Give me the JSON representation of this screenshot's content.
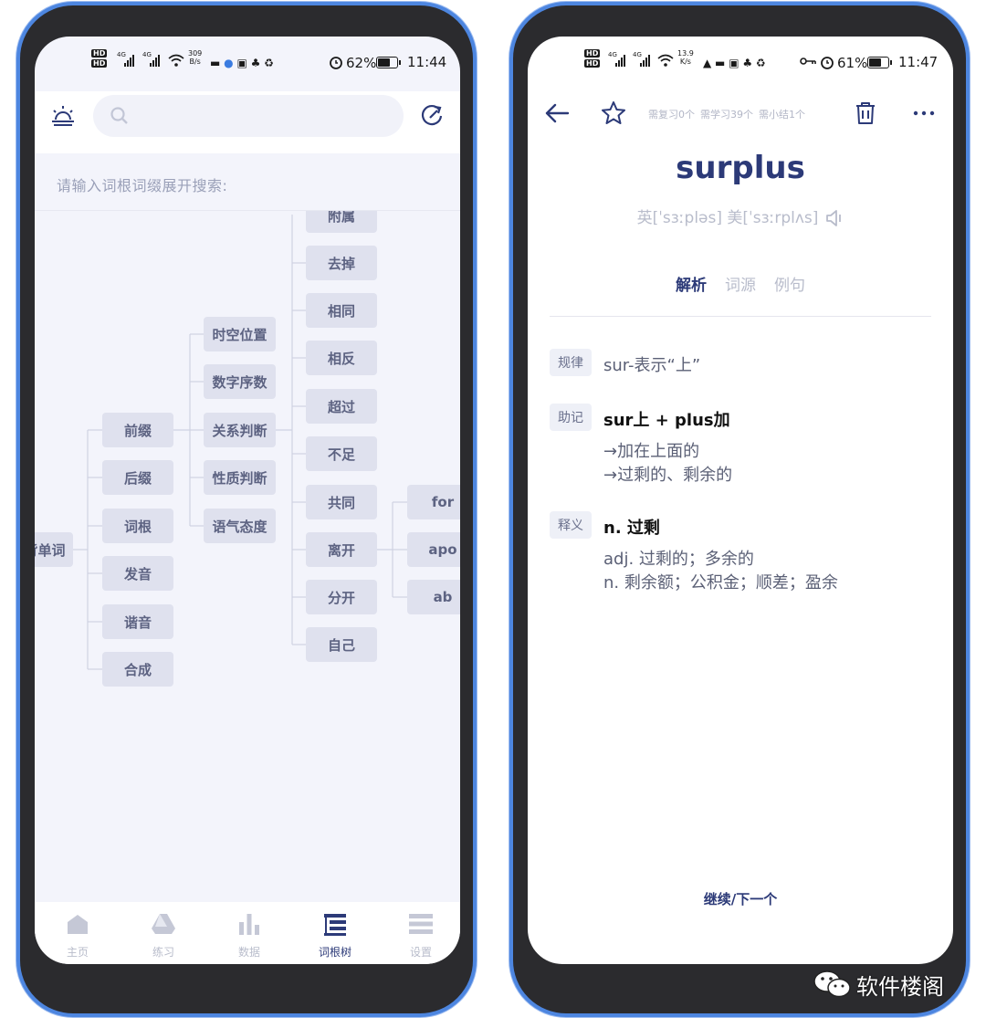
{
  "left": {
    "status": {
      "hd1": "HD",
      "hd2": "HD",
      "net1": "4G",
      "net2": "4G",
      "speed_value": "309",
      "speed_unit": "B/s",
      "battery": "62%",
      "time": "11:44"
    },
    "search": {
      "placeholder": ""
    },
    "hint": "请输入词根词缀展开搜索:",
    "tree": {
      "root": "背单词",
      "level1": [
        "前缀",
        "后缀",
        "词根",
        "发音",
        "谐音",
        "合成"
      ],
      "level2": [
        "时空位置",
        "数字序数",
        "关系判断",
        "性质判断",
        "语气态度"
      ],
      "level3": [
        "附属",
        "去掉",
        "相同",
        "相反",
        "超过",
        "不足",
        "共同",
        "离开",
        "分开",
        "自己"
      ],
      "level4": [
        "for",
        "apo",
        "ab"
      ]
    },
    "tabs": [
      {
        "label": "主页",
        "icon": "home-icon"
      },
      {
        "label": "练习",
        "icon": "practice-icon"
      },
      {
        "label": "数据",
        "icon": "chart-icon"
      },
      {
        "label": "词根树",
        "icon": "tree-icon"
      },
      {
        "label": "设置",
        "icon": "settings-icon"
      }
    ],
    "active_tab": "词根树"
  },
  "right": {
    "status": {
      "hd1": "HD",
      "hd2": "HD",
      "net1": "4G",
      "net2": "4G",
      "speed_value": "13.9",
      "speed_unit": "K/s",
      "battery": "61%",
      "time": "11:47"
    },
    "stats": {
      "review": "需复习0个",
      "learn": "需学习39个",
      "summary": "需小结1个"
    },
    "word": "surplus",
    "phonetic": "英[ˈsɜːpləs] 美[ˈsɜːrplʌs]",
    "tabs": [
      "解析",
      "词源",
      "例句"
    ],
    "active_tab": "解析",
    "sections": {
      "rule": {
        "tag": "规律",
        "text": "sur-表示“上”"
      },
      "mnemonic": {
        "tag": "助记",
        "text": "sur上 + plus加",
        "lines": [
          "→加在上面的",
          "→过剩的、剩余的"
        ]
      },
      "definition": {
        "tag": "释义",
        "text": "n. 过剩",
        "lines": [
          "adj. 过剩的；多余的",
          "n. 剩余额；公积金；顺差；盈余"
        ]
      }
    },
    "next_label": "继续/下一个"
  },
  "watermark": "软件楼阁",
  "colors": {
    "accent": "#2c3a78",
    "frame": "#4d86e0",
    "node_bg": "#dfe1ee"
  }
}
